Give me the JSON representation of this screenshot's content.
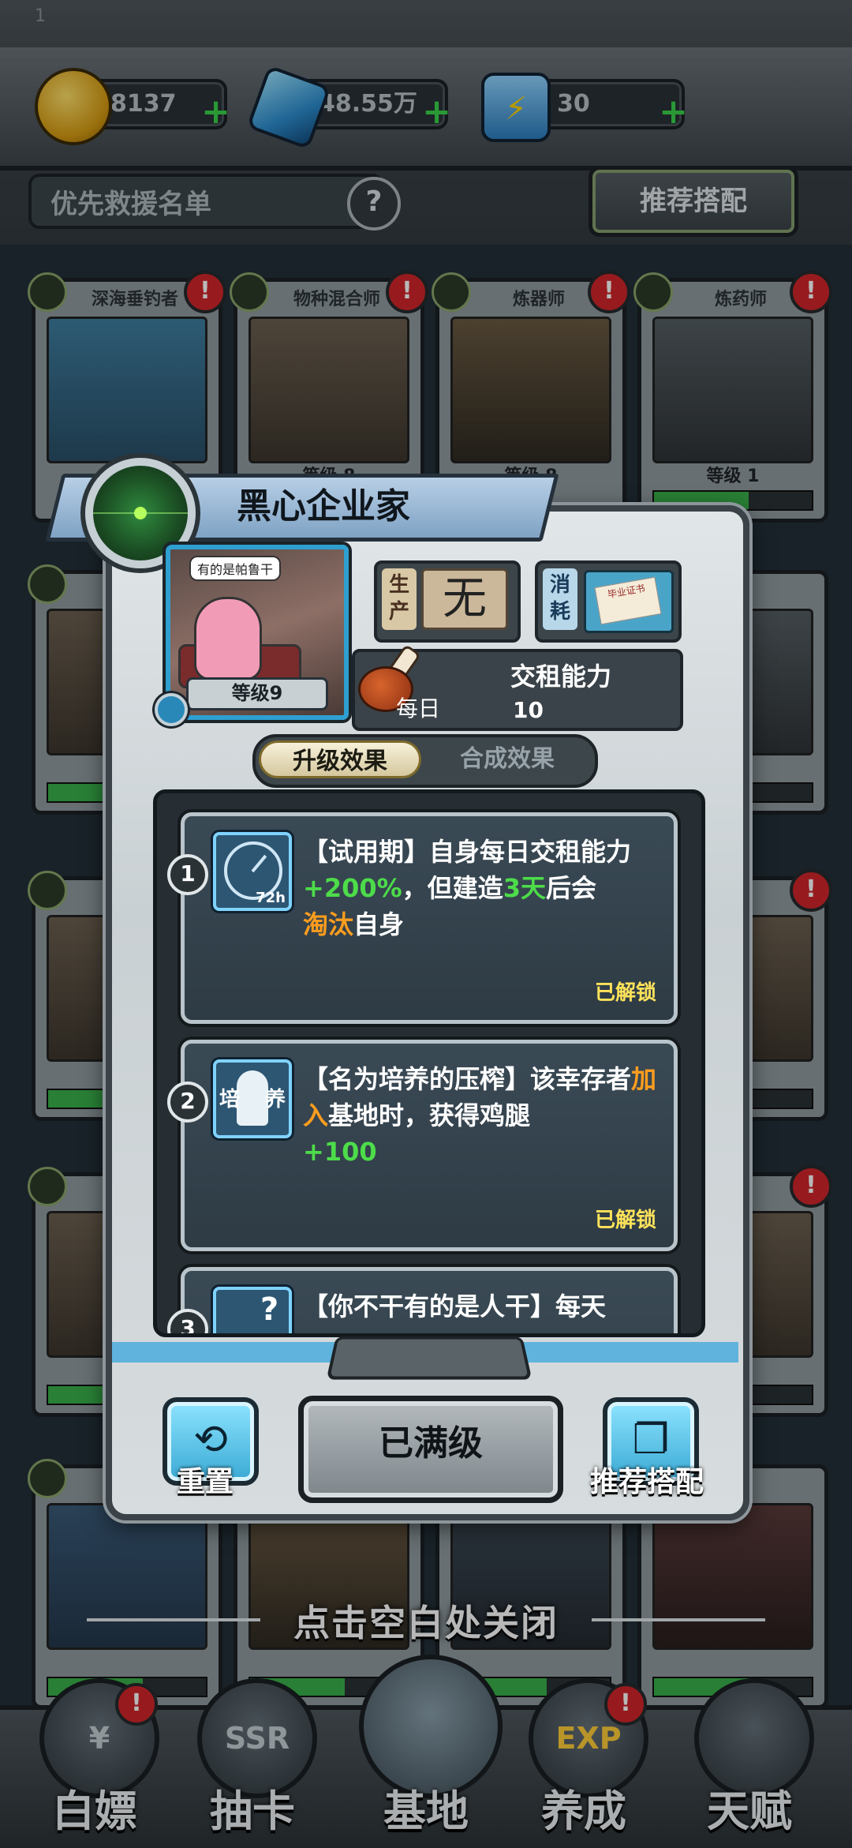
{
  "status_bar": {
    "indicator": "1"
  },
  "resources": {
    "gold": "8137",
    "gems": "48.55万",
    "energy": "30",
    "plus": "+"
  },
  "toolbar": {
    "priority_label": "优先救援名单",
    "help_symbol": "?",
    "recommend_label": "推荐搭配"
  },
  "background_cards": [
    {
      "name": "深海垂钓者",
      "level": ""
    },
    {
      "name": "物种混合师",
      "level": "等级 8"
    },
    {
      "name": "炼器师",
      "level": "等级 8"
    },
    {
      "name": "炼药师",
      "level": "等级 1"
    }
  ],
  "modal": {
    "title": "黑心企业家",
    "portrait_speech": "有的是帕鲁干",
    "portrait_level": "等级9",
    "production_tag": "生产",
    "production_value": "无",
    "consumption_tag": "消耗",
    "rent": {
      "title": "交租能力",
      "period": "每日",
      "amount": "10"
    },
    "tabs": {
      "upgrade": "升级效果",
      "synthesis": "合成效果"
    },
    "effects": [
      {
        "number": "1",
        "icon_text": "72h",
        "desc_part1": "【试用期】自身每日交租能力",
        "desc_green1": "+200%",
        "desc_part2": "，但建造",
        "desc_green2": "3天",
        "desc_part3": "后会",
        "desc_orange": "淘汰",
        "desc_part4": "自身",
        "status": "已解锁"
      },
      {
        "number": "2",
        "icon_left": "培",
        "icon_right": "养",
        "desc_part1": "【名为培养的压榨】该幸存者",
        "desc_orange": "加入",
        "desc_part2": "基地时，获得鸡腿",
        "desc_green": "+100",
        "status": "已解锁"
      },
      {
        "number": "3",
        "icon_text": "?",
        "desc_part1": "【你不干有的是人干】每天"
      }
    ],
    "reset_label": "重置",
    "maxed_label": "已满级",
    "recommend_label": "推荐搭配"
  },
  "close_hint": "点击空白处关闭",
  "bottom_nav": [
    {
      "label": "白嫖",
      "icon_text": "¥"
    },
    {
      "label": "抽卡",
      "icon_text": "SSR"
    },
    {
      "label": "基地",
      "icon_text": ""
    },
    {
      "label": "养成",
      "icon_text": "EXP"
    },
    {
      "label": "天赋",
      "icon_text": ""
    }
  ],
  "colors": {
    "accent_blue": "#5fb3dd",
    "green_text": "#4ddc4a",
    "orange_text": "#ff9d1e",
    "unlocked_yellow": "#ffe35a",
    "alert_red": "#d2262a"
  }
}
